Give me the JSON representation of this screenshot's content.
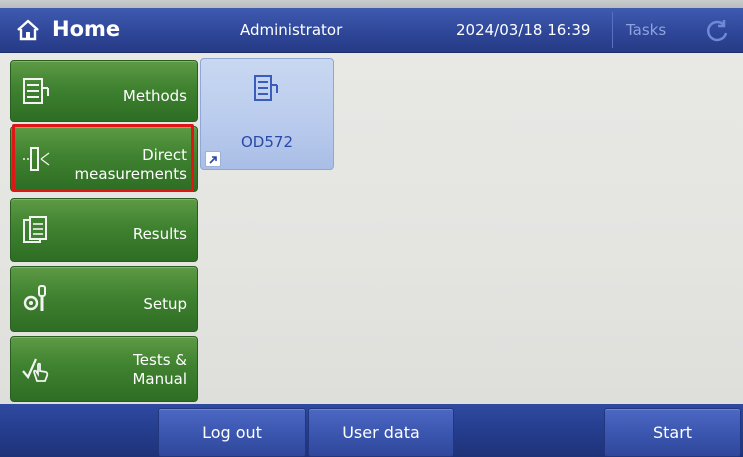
{
  "header": {
    "title": "Home",
    "user": "Administrator",
    "datetime": "2024/03/18 16:39",
    "tasks_label": "Tasks",
    "home_icon": "home-icon",
    "refresh_icon": "refresh-icon"
  },
  "sidebar": {
    "items": [
      {
        "label_line1": "Methods",
        "label_line2": "",
        "icon": "methods-icon",
        "selected": false
      },
      {
        "label_line1": "Direct",
        "label_line2": "measurements",
        "icon": "direct-measurement-icon",
        "selected": true
      },
      {
        "label_line1": "Results",
        "label_line2": "",
        "icon": "results-icon",
        "selected": false
      },
      {
        "label_line1": "Setup",
        "label_line2": "",
        "icon": "setup-icon",
        "selected": false
      },
      {
        "label_line1": "Tests &",
        "label_line2": "Manual",
        "icon": "tests-manual-icon",
        "selected": false
      }
    ]
  },
  "main": {
    "tiles": [
      {
        "label": "OD572",
        "icon": "method-icon",
        "shortcut_icon": "shortcut-arrow-icon"
      }
    ]
  },
  "footer": {
    "logout_label": "Log out",
    "userdata_label": "User data",
    "start_label": "Start"
  },
  "colors": {
    "header_blue": "#2f4799",
    "menu_green": "#3f8230",
    "selection_red": "#e01616",
    "tile_blue": "#b9cbed"
  }
}
